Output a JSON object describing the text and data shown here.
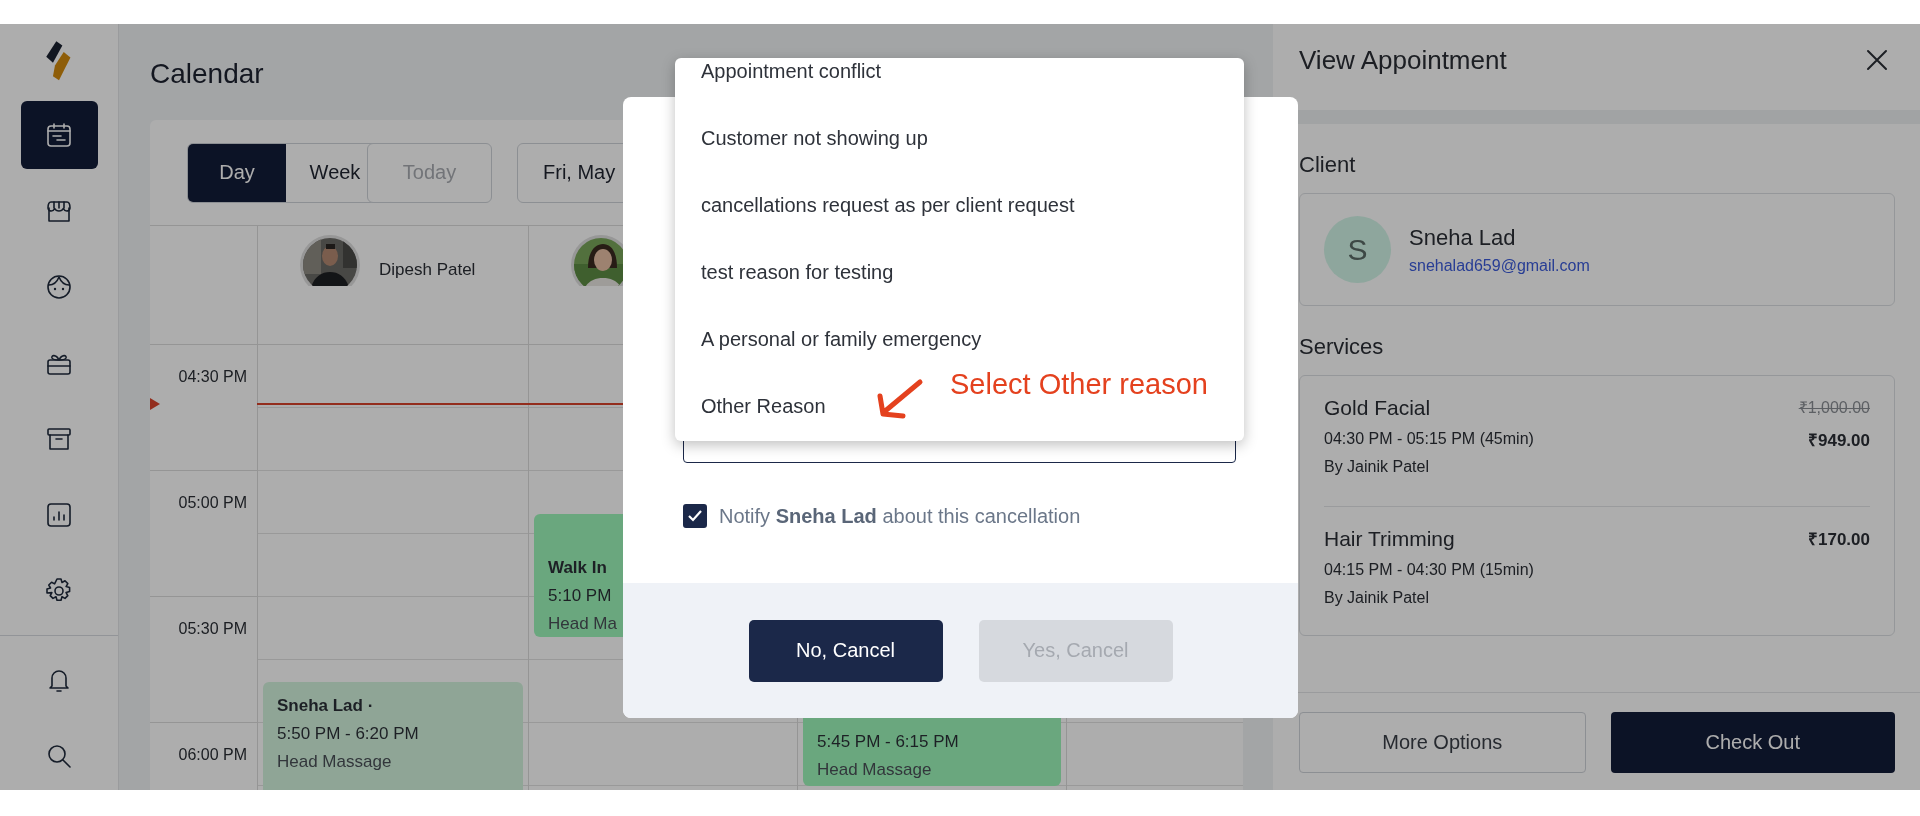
{
  "sidebar": {
    "nav": [
      {
        "selected": true
      },
      {
        "selected": false
      },
      {
        "selected": false
      },
      {
        "selected": false
      },
      {
        "selected": false
      },
      {
        "selected": false
      },
      {
        "selected": false
      }
    ],
    "utility": [
      {
        "selected": false
      },
      {
        "selected": false
      }
    ]
  },
  "calendar": {
    "title": "Calendar",
    "views": [
      {
        "label": "Day",
        "selected": true
      },
      {
        "label": "Week",
        "selected": false
      }
    ],
    "today_button": {
      "label": "Today",
      "disabled": true
    },
    "date_button": {
      "label": "Fri, May"
    },
    "times": [
      "04:30 PM",
      "05:00 PM",
      "05:30 PM",
      "06:00 PM"
    ],
    "columns": [
      {
        "name": "Dipesh Patel",
        "avatar": {
          "kind": "picture"
        },
        "events": [
          {
            "name": "Sneha Lad ·",
            "time": "5:50 PM - 6:20 PM",
            "service": "Head Massage",
            "color": "#8fa596"
          }
        ]
      },
      {
        "avatar": {
          "kind": "picture"
        },
        "events": [
          {
            "name": "Walk In",
            "time": "5:10 PM",
            "service": "Head Ma",
            "color": "#6aa77e"
          }
        ]
      },
      {
        "events": [
          {
            "time": "5:45 PM - 6:15 PM",
            "service": "Head Massage",
            "color": "#6aa77e"
          }
        ]
      },
      {}
    ]
  },
  "view_appointment": {
    "title": "View Appointment",
    "client_heading": "Client",
    "client": {
      "initial": "S",
      "name": "Sneha Lad",
      "email": "snehalad659@gmail.com"
    },
    "services_heading": "Services",
    "services": [
      {
        "name": "Gold Facial",
        "time": "04:30 PM - 05:15 PM (45min)",
        "staff": "By Jainik Patel",
        "original_price": "₹1,000.00",
        "price": "₹949.00"
      },
      {
        "name": "Hair Trimming",
        "time": "04:15 PM - 04:30 PM (15min)",
        "staff": "By Jainik Patel",
        "price": "₹170.00"
      }
    ],
    "buttons": [
      {
        "label": "More Options",
        "kind": "secondary"
      },
      {
        "label": "Check Out",
        "kind": "primary"
      }
    ]
  },
  "cancel_dialog": {
    "reason_options": [
      {
        "label": "Appointment conflict"
      },
      {
        "label": "Customer not showing up"
      },
      {
        "label": "cancellations request as per client request"
      },
      {
        "label": "test reason for testing"
      },
      {
        "label": "A personal or family emergency"
      },
      {
        "label": "Other Reason"
      }
    ],
    "notify": {
      "text": "Notify **Sneha Lad** about this cancellation",
      "checked": true
    },
    "buttons": [
      {
        "label": "No, Cancel",
        "kind": "primary",
        "disabled": false
      },
      {
        "label": "Yes, Cancel",
        "kind": "primary",
        "disabled": true
      }
    ]
  },
  "annotation": {
    "text": "Select Other reason"
  }
}
